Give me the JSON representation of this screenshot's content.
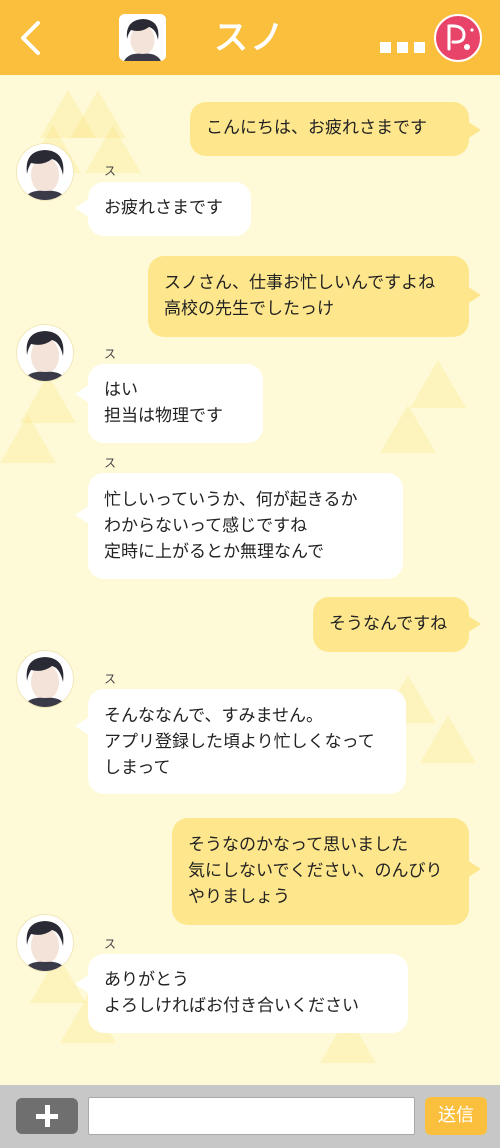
{
  "header": {
    "contact_name": "スノ",
    "logo_icon": "pearl-logo-icon",
    "back_icon": "chevron-left-icon",
    "menu_icon": "ellipsis-icon"
  },
  "messages": [
    {
      "type": "sent",
      "text": "こんにちは、お疲れさまです"
    },
    {
      "type": "received",
      "sender": "スノ",
      "text": "お疲れさまです"
    },
    {
      "type": "sent",
      "text": "スノさん、仕事お忙しいんですよね\n高校の先生でしたっけ"
    },
    {
      "type": "received",
      "sender": "スノ",
      "text": "はい\n担当は物理です"
    },
    {
      "type": "received",
      "sender": "スノ",
      "text": "忙しいっていうか、何が起きるか\nわからないって感じですね\n定時に上がるとか無理なんで"
    },
    {
      "type": "sent",
      "text": "そうなんですね"
    },
    {
      "type": "received",
      "sender": "スノ",
      "text": "そんななんで、すみません。\nアプリ登録した頃より忙しくなって\nしまって"
    },
    {
      "type": "sent",
      "text": "そうなのかなって思いました\n気にしないでください、のんびり\nやりましょう"
    },
    {
      "type": "received",
      "sender": "スノ",
      "text": "ありがとう\nよろしければお付き合いください"
    }
  ],
  "input": {
    "value": "",
    "placeholder": ""
  },
  "send_label": "送信",
  "colors": {
    "header": "#fbbf3e",
    "background": "#fefad8",
    "sent_bubble": "#fde68c",
    "received_bubble": "#ffffff",
    "bottom_bar": "#c7c7c7"
  }
}
